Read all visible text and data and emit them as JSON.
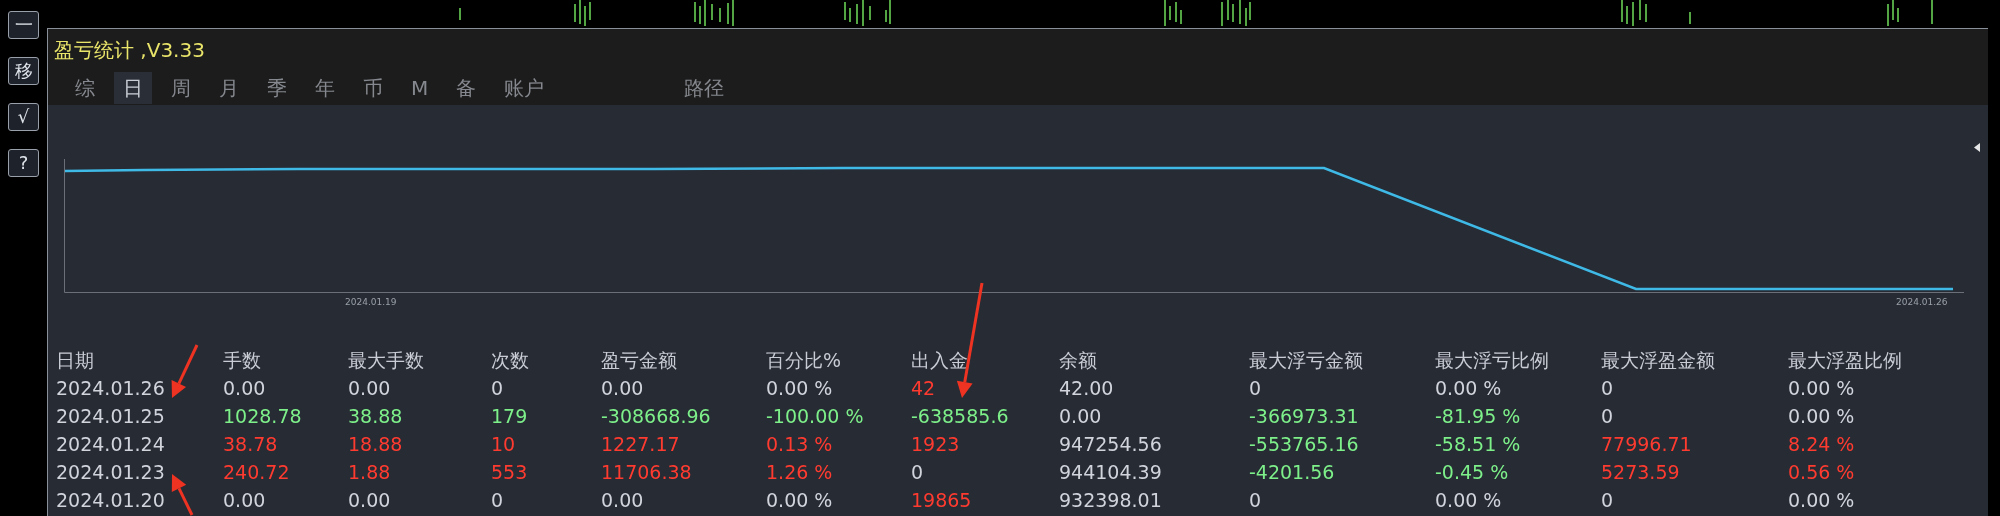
{
  "window": {
    "title": "盈亏统计 ,V3.33"
  },
  "side_buttons": [
    "一",
    "移",
    "√",
    "?"
  ],
  "tabs": [
    {
      "label": "综",
      "selected": false
    },
    {
      "label": "日",
      "selected": true
    },
    {
      "label": "周",
      "selected": false
    },
    {
      "label": "月",
      "selected": false
    },
    {
      "label": "季",
      "selected": false
    },
    {
      "label": "年",
      "selected": false
    },
    {
      "label": "币",
      "selected": false
    },
    {
      "label": "M",
      "selected": false
    },
    {
      "label": "备",
      "selected": false
    },
    {
      "label": "账户",
      "selected": false
    }
  ],
  "path_button": {
    "label": "路径"
  },
  "chart": {
    "x_labels": [
      "2024.01.19",
      "2024.01.26"
    ]
  },
  "table": {
    "columns": [
      "日期",
      "手数",
      "最大手数",
      "次数",
      "盈亏金额",
      "百分比%",
      "出入金",
      "余额",
      "最大浮亏金额",
      "最大浮亏比例",
      "最大浮盈金额",
      "最大浮盈比例"
    ],
    "rows": [
      {
        "cells": [
          {
            "text": "2024.01.26",
            "color": "#d2d4dc"
          },
          {
            "text": "0.00",
            "color": "#d2d4dc"
          },
          {
            "text": "0.00",
            "color": "#d2d4dc"
          },
          {
            "text": "0",
            "color": "#d2d4dc"
          },
          {
            "text": "0.00",
            "color": "#d2d4dc"
          },
          {
            "text": "0.00 %",
            "color": "#d2d4dc"
          },
          {
            "text": "42",
            "color": "#ff3b30"
          },
          {
            "text": "42.00",
            "color": "#d2d4dc"
          },
          {
            "text": "0",
            "color": "#d2d4dc"
          },
          {
            "text": "0.00 %",
            "color": "#d2d4dc"
          },
          {
            "text": "0",
            "color": "#d2d4dc"
          },
          {
            "text": "0.00 %",
            "color": "#d2d4dc"
          }
        ]
      },
      {
        "cells": [
          {
            "text": "2024.01.25",
            "color": "#d2d4dc"
          },
          {
            "text": "1028.78",
            "color": "#7ef08a"
          },
          {
            "text": "38.88",
            "color": "#7ef08a"
          },
          {
            "text": "179",
            "color": "#7ef08a"
          },
          {
            "text": "-308668.96",
            "color": "#7ef08a"
          },
          {
            "text": "-100.00 %",
            "color": "#7ef08a"
          },
          {
            "text": "-638585.6",
            "color": "#7ef08a"
          },
          {
            "text": "0.00",
            "color": "#d2d4dc"
          },
          {
            "text": "-366973.31",
            "color": "#7ef08a"
          },
          {
            "text": "-81.95 %",
            "color": "#7ef08a"
          },
          {
            "text": "0",
            "color": "#d2d4dc"
          },
          {
            "text": "0.00 %",
            "color": "#d2d4dc"
          }
        ]
      },
      {
        "cells": [
          {
            "text": "2024.01.24",
            "color": "#d2d4dc"
          },
          {
            "text": "38.78",
            "color": "#ff3b30"
          },
          {
            "text": "18.88",
            "color": "#ff3b30"
          },
          {
            "text": "10",
            "color": "#ff3b30"
          },
          {
            "text": "1227.17",
            "color": "#ff3b30"
          },
          {
            "text": "0.13 %",
            "color": "#ff3b30"
          },
          {
            "text": "1923",
            "color": "#ff3b30"
          },
          {
            "text": "947254.56",
            "color": "#d2d4dc"
          },
          {
            "text": "-553765.16",
            "color": "#7ef08a"
          },
          {
            "text": "-58.51 %",
            "color": "#7ef08a"
          },
          {
            "text": "77996.71",
            "color": "#ff3b30"
          },
          {
            "text": "8.24 %",
            "color": "#ff3b30"
          }
        ]
      },
      {
        "cells": [
          {
            "text": "2024.01.23",
            "color": "#d2d4dc"
          },
          {
            "text": "240.72",
            "color": "#ff3b30"
          },
          {
            "text": "1.88",
            "color": "#ff3b30"
          },
          {
            "text": "553",
            "color": "#ff3b30"
          },
          {
            "text": "11706.38",
            "color": "#ff3b30"
          },
          {
            "text": "1.26 %",
            "color": "#ff3b30"
          },
          {
            "text": "0",
            "color": "#d2d4dc"
          },
          {
            "text": "944104.39",
            "color": "#d2d4dc"
          },
          {
            "text": "-4201.56",
            "color": "#7ef08a"
          },
          {
            "text": "-0.45 %",
            "color": "#7ef08a"
          },
          {
            "text": "5273.59",
            "color": "#ff3b30"
          },
          {
            "text": "0.56 %",
            "color": "#ff3b30"
          }
        ]
      },
      {
        "cells": [
          {
            "text": "2024.01.20",
            "color": "#d2d4dc"
          },
          {
            "text": "0.00",
            "color": "#d2d4dc"
          },
          {
            "text": "0.00",
            "color": "#d2d4dc"
          },
          {
            "text": "0",
            "color": "#d2d4dc"
          },
          {
            "text": "0.00",
            "color": "#d2d4dc"
          },
          {
            "text": "0.00 %",
            "color": "#d2d4dc"
          },
          {
            "text": "19865",
            "color": "#ff3b30"
          },
          {
            "text": "932398.01",
            "color": "#d2d4dc"
          },
          {
            "text": "0",
            "color": "#d2d4dc"
          },
          {
            "text": "0.00 %",
            "color": "#d2d4dc"
          },
          {
            "text": "0",
            "color": "#d2d4dc"
          },
          {
            "text": "0.00 %",
            "color": "#d2d4dc"
          }
        ]
      }
    ]
  }
}
